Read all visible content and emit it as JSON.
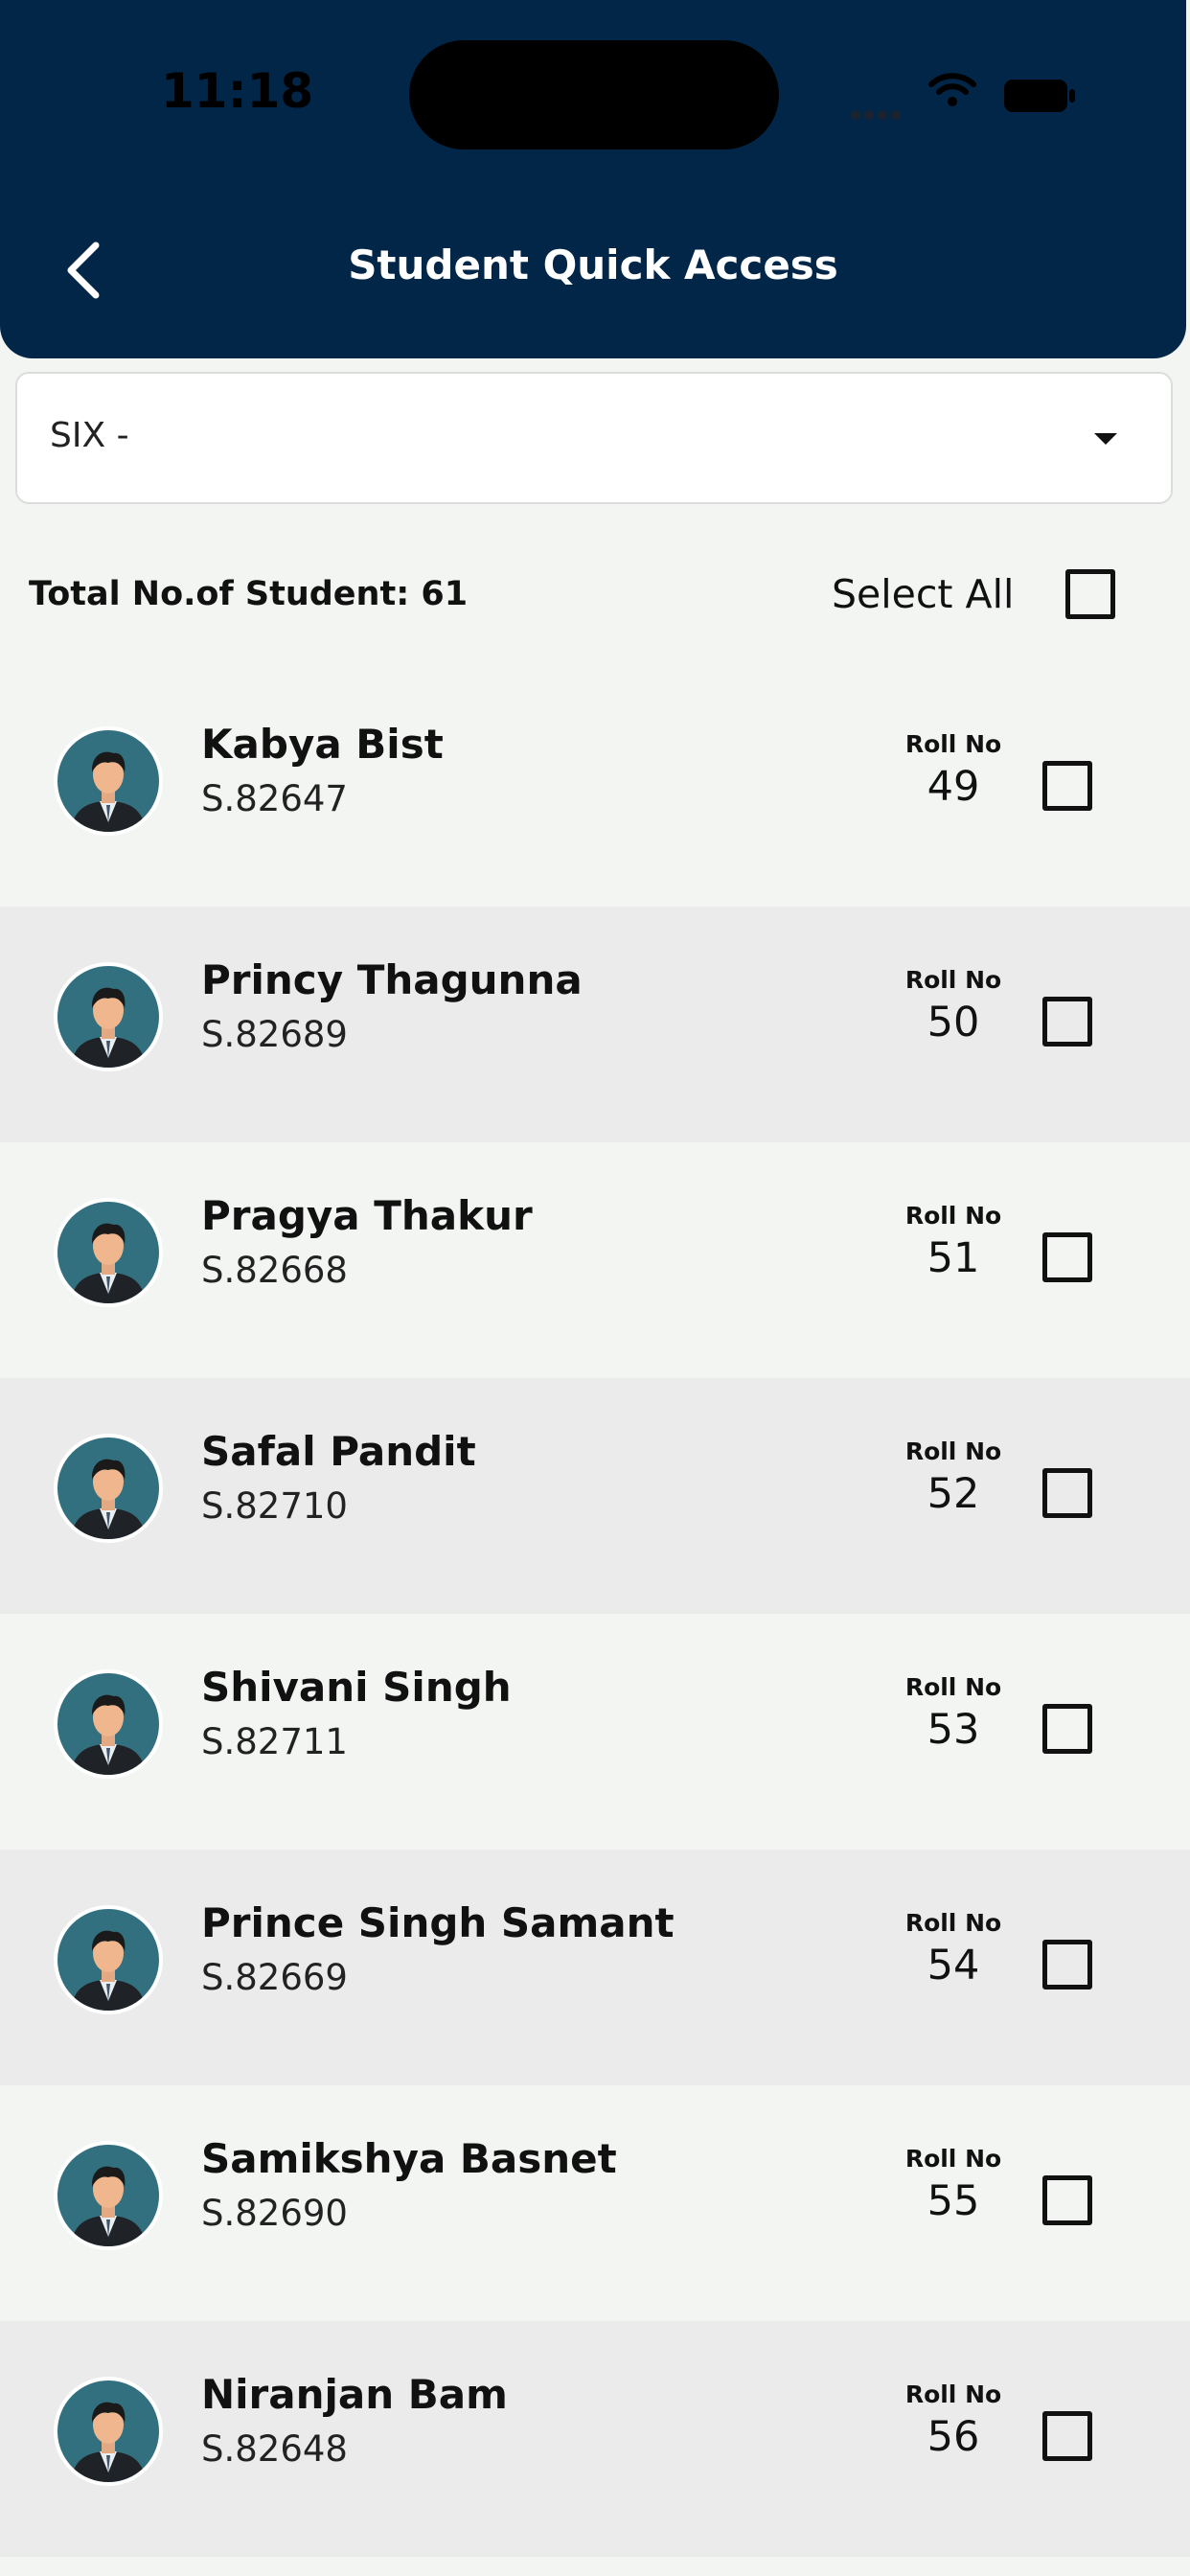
{
  "status_bar": {
    "time": "11:18"
  },
  "header": {
    "title": "Student Quick Access"
  },
  "class_select": {
    "value": "SIX -"
  },
  "summary": {
    "total_label": "Total No.of Student: 61",
    "select_all_label": "Select All"
  },
  "roll_label": "Roll No",
  "students": [
    {
      "name": "Kabya Bist",
      "id": "S.82647",
      "roll": "49"
    },
    {
      "name": "Princy Thagunna",
      "id": "S.82689",
      "roll": "50"
    },
    {
      "name": "Pragya Thakur",
      "id": "S.82668",
      "roll": "51"
    },
    {
      "name": "Safal Pandit",
      "id": "S.82710",
      "roll": "52"
    },
    {
      "name": "Shivani Singh",
      "id": "S.82711",
      "roll": "53"
    },
    {
      "name": "Prince Singh Samant",
      "id": "S.82669",
      "roll": "54"
    },
    {
      "name": "Samikshya Basnet",
      "id": "S.82690",
      "roll": "55"
    },
    {
      "name": "Niranjan Bam",
      "id": "S.82648",
      "roll": "56"
    }
  ],
  "colors": {
    "header": "#022647",
    "avatar_bg": "#32707f",
    "row_alt": "#ebebeb",
    "page_bg": "#f3f5f3"
  }
}
